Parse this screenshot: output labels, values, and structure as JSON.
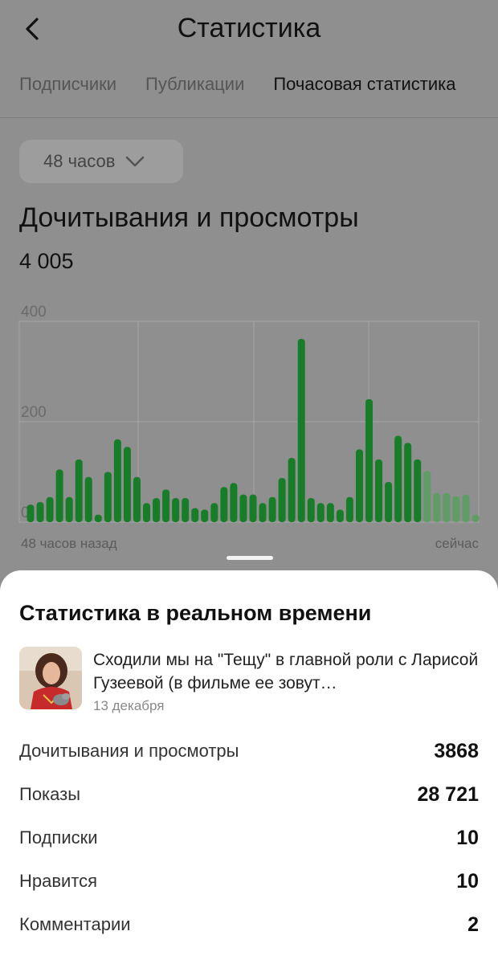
{
  "header": {
    "title": "Статистика",
    "back_icon": "chevron-left-icon"
  },
  "tabs": [
    {
      "label": "Подписчики",
      "active": false
    },
    {
      "label": "Публикации",
      "active": false
    },
    {
      "label": "Почасовая статистика",
      "active": true
    }
  ],
  "period": {
    "label": "48 часов",
    "icon": "chevron-down-icon"
  },
  "section": {
    "title": "Дочитывания и просмотры",
    "total": "4 005"
  },
  "chart_data": {
    "type": "bar",
    "title": "",
    "xlabel": "",
    "ylabel": "",
    "ylim": [
      0,
      400
    ],
    "yticks": [
      "400",
      "200",
      "0"
    ],
    "x_start_label": "48 часов назад",
    "x_end_label": "сейчас",
    "grid": true,
    "colors": {
      "bar": "#187d28",
      "bar_recent": "#5f9c66"
    },
    "values": [
      35,
      40,
      50,
      105,
      50,
      125,
      90,
      15,
      100,
      165,
      150,
      90,
      38,
      48,
      65,
      48,
      48,
      28,
      25,
      38,
      70,
      78,
      55,
      55,
      38,
      50,
      88,
      128,
      365,
      48,
      38,
      38,
      25,
      50,
      145,
      245,
      125,
      80,
      172,
      158,
      125,
      102,
      58,
      58,
      52,
      55,
      15
    ],
    "recent_from_index": 41
  },
  "sheet": {
    "title": "Статистика в реальном времени",
    "article": {
      "title": "Сходили мы на \"Тещу\" в главной роли с Ларисой Гузеевой (в фильме ее зовут…",
      "date": "13 декабря"
    },
    "metrics": [
      {
        "label": "Дочитывания и просмотры",
        "value": "3868"
      },
      {
        "label": "Показы",
        "value": "28 721"
      },
      {
        "label": "Подписки",
        "value": "10"
      },
      {
        "label": "Нравится",
        "value": "10"
      },
      {
        "label": "Комментарии",
        "value": "2"
      }
    ]
  }
}
